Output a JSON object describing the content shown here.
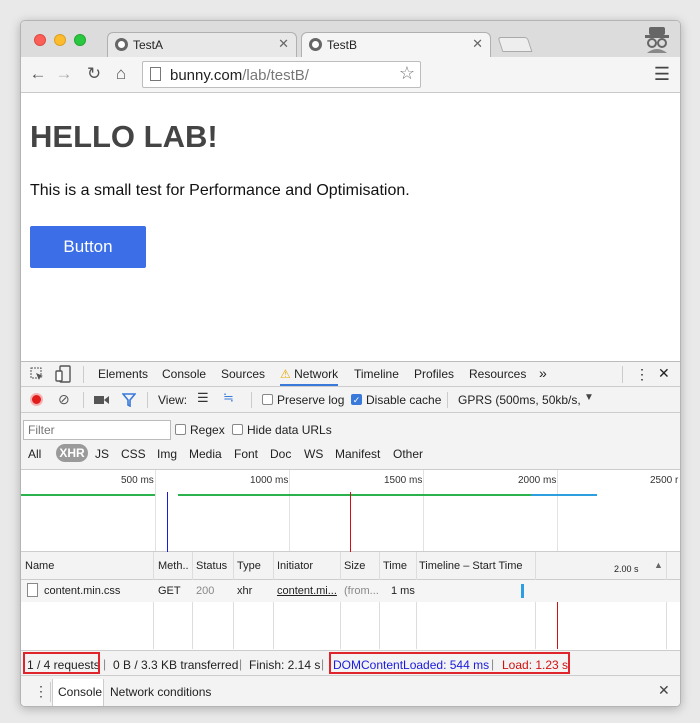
{
  "browser": {
    "tabs": [
      {
        "title": "TestA",
        "active": false
      },
      {
        "title": "TestB",
        "active": true
      }
    ],
    "url_host": "bunny.com",
    "url_path": "/lab/testB/"
  },
  "page": {
    "heading": "HELLO LAB!",
    "paragraph": "This is a small test for Performance and Optimisation.",
    "button_label": "Button",
    "button_color": "#3b6ee7"
  },
  "devtools": {
    "panels": [
      "Elements",
      "Console",
      "Sources",
      "Network",
      "Timeline",
      "Profiles",
      "Resources"
    ],
    "active_panel": "Network",
    "more_panels": "»",
    "toolbar": {
      "view_label": "View:",
      "preserve_log": "Preserve log",
      "disable_cache": "Disable cache",
      "throttling": "GPRS (500ms, 50kb/s,"
    },
    "filter": {
      "placeholder": "Filter",
      "regex": "Regex",
      "hide_data_urls": "Hide data URLs",
      "types": [
        "All",
        "XHR",
        "JS",
        "CSS",
        "Img",
        "Media",
        "Font",
        "Doc",
        "WS",
        "Manifest",
        "Other"
      ],
      "active_type": "XHR"
    },
    "overview_ticks": [
      "500 ms",
      "1000 ms",
      "1500 ms",
      "2000 ms",
      "2500 r"
    ],
    "columns": [
      "Name",
      "Meth..",
      "Status",
      "Type",
      "Initiator",
      "Size",
      "Time",
      "Timeline – Start Time",
      "2.00 s"
    ],
    "rows": [
      {
        "name": "content.min.css",
        "method": "GET",
        "status": "200",
        "type": "xhr",
        "initiator": "content.mi...",
        "size": "(from...",
        "time": "1 ms"
      }
    ],
    "summary": {
      "requests": "1 / 4 requests",
      "transferred": "0 B / 3.3 KB transferred",
      "finish": "Finish: 2.14 s",
      "dom_content_loaded": "DOMContentLoaded: 544 ms",
      "load": "Load: 1.23 s"
    },
    "drawer": {
      "tabs": [
        "Console",
        "Network conditions"
      ]
    },
    "colors": {
      "dcl_blue": "#1a1add",
      "load_red": "#d31010",
      "highlight_red": "#e0242b",
      "active_tab_blue": "#3879d9"
    }
  }
}
